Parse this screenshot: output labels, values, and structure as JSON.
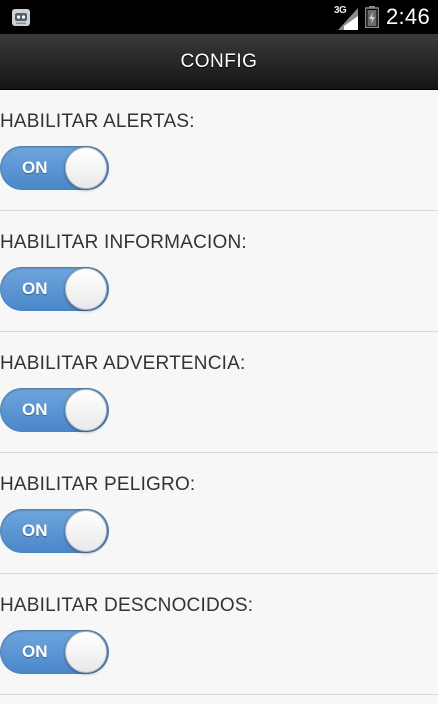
{
  "status_bar": {
    "app_icon": "android-robot-icon",
    "network_type": "3G",
    "signal_icon": "signal-bars-icon",
    "battery_icon": "battery-icon",
    "time": "2:46"
  },
  "header": {
    "title": "CONFIG"
  },
  "colors": {
    "toggle_on": "#5a96d3",
    "header_bg": "#1e1e1e",
    "page_bg": "#f7f7f7"
  },
  "settings": [
    {
      "label": "HABILITAR ALERTAS:",
      "toggle": "ON"
    },
    {
      "label": "HABILITAR INFORMACION:",
      "toggle": "ON"
    },
    {
      "label": "HABILITAR ADVERTENCIA:",
      "toggle": "ON"
    },
    {
      "label": "HABILITAR PELIGRO:",
      "toggle": "ON"
    },
    {
      "label": "HABILITAR DESCNOCIDOS:",
      "toggle": "ON"
    }
  ]
}
